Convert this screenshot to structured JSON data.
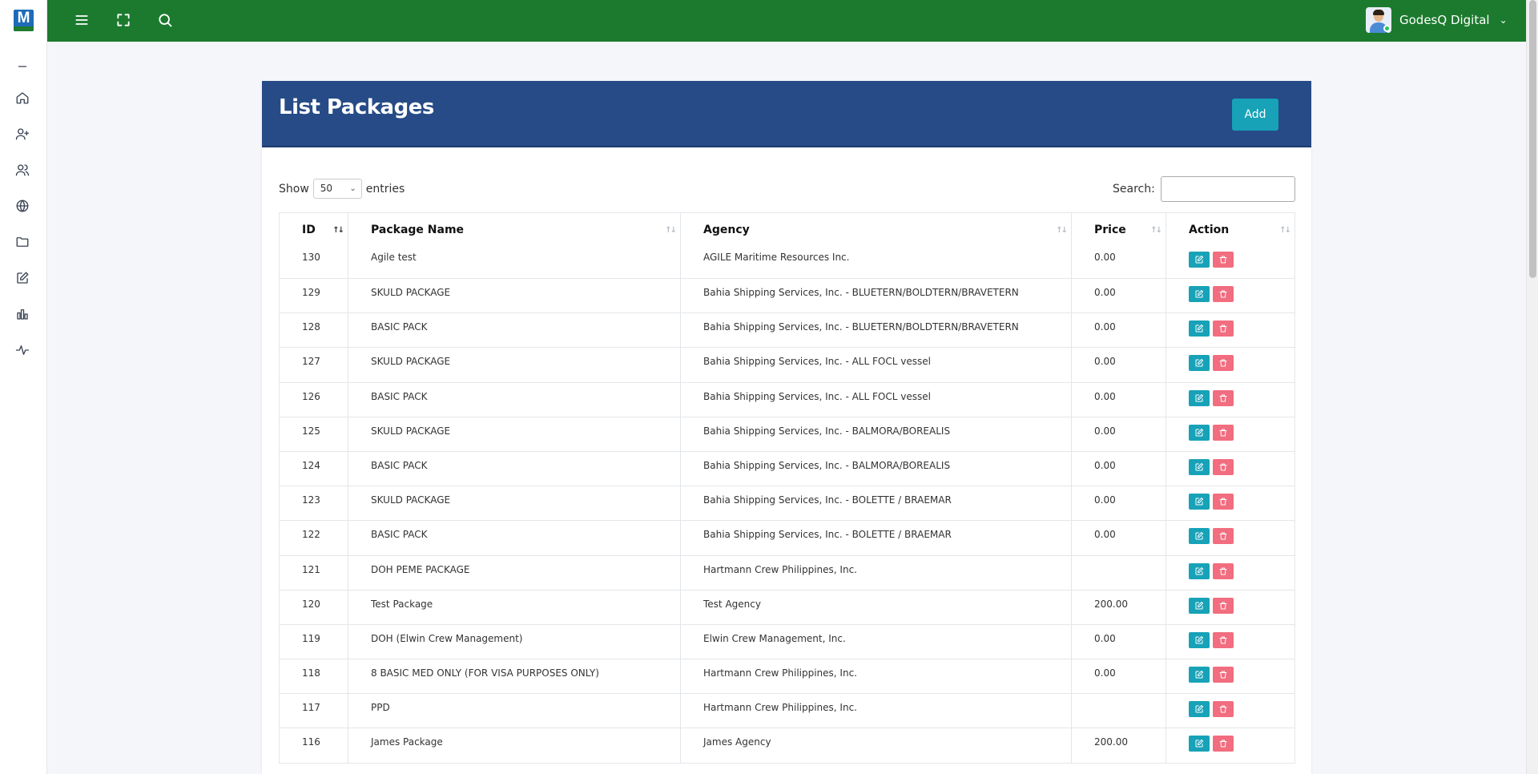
{
  "app": {
    "logo_text": "M",
    "user_name": "GodesQ Digital"
  },
  "sidebar": {
    "items": [
      {
        "name": "collapse",
        "icon": "minus-icon"
      },
      {
        "name": "home",
        "icon": "home-icon"
      },
      {
        "name": "add-user",
        "icon": "user-plus-icon"
      },
      {
        "name": "users",
        "icon": "users-icon"
      },
      {
        "name": "globe",
        "icon": "globe-icon"
      },
      {
        "name": "folder",
        "icon": "folder-icon"
      },
      {
        "name": "edit",
        "icon": "edit-icon"
      },
      {
        "name": "reports",
        "icon": "bar-chart-icon"
      },
      {
        "name": "activity",
        "icon": "activity-icon"
      }
    ]
  },
  "page": {
    "title": "List Packages",
    "add_label": "Add",
    "show_label": "Show",
    "entries_value": "50",
    "entries_label": "entries",
    "search_label": "Search:"
  },
  "table": {
    "headers": [
      "ID",
      "Package Name",
      "Agency",
      "Price",
      "Action"
    ],
    "rows": [
      {
        "id": "130",
        "name": "Agile test",
        "agency": "AGILE Maritime Resources Inc.",
        "price": "0.00"
      },
      {
        "id": "129",
        "name": "SKULD PACKAGE",
        "agency": "Bahia Shipping Services, Inc. - BLUETERN/BOLDTERN/BRAVETERN",
        "price": "0.00"
      },
      {
        "id": "128",
        "name": "BASIC PACK",
        "agency": "Bahia Shipping Services, Inc. - BLUETERN/BOLDTERN/BRAVETERN",
        "price": "0.00"
      },
      {
        "id": "127",
        "name": "SKULD PACKAGE",
        "agency": "Bahia Shipping Services, Inc. - ALL FOCL vessel",
        "price": "0.00"
      },
      {
        "id": "126",
        "name": "BASIC PACK",
        "agency": "Bahia Shipping Services, Inc. - ALL FOCL vessel",
        "price": "0.00"
      },
      {
        "id": "125",
        "name": "SKULD PACKAGE",
        "agency": "Bahia Shipping Services, Inc. - BALMORA/BOREALIS",
        "price": "0.00"
      },
      {
        "id": "124",
        "name": "BASIC PACK",
        "agency": "Bahia Shipping Services, Inc. - BALMORA/BOREALIS",
        "price": "0.00"
      },
      {
        "id": "123",
        "name": "SKULD PACKAGE",
        "agency": "Bahia Shipping Services, Inc. - BOLETTE / BRAEMAR",
        "price": "0.00"
      },
      {
        "id": "122",
        "name": "BASIC PACK",
        "agency": "Bahia Shipping Services, Inc. - BOLETTE / BRAEMAR",
        "price": "0.00"
      },
      {
        "id": "121",
        "name": "DOH PEME PACKAGE",
        "agency": "Hartmann Crew Philippines, Inc.",
        "price": ""
      },
      {
        "id": "120",
        "name": "Test Package",
        "agency": "Test Agency",
        "price": "200.00"
      },
      {
        "id": "119",
        "name": "DOH (Elwin Crew Management)",
        "agency": "Elwin Crew Management, Inc.",
        "price": "0.00"
      },
      {
        "id": "118",
        "name": "8 BASIC MED ONLY (FOR VISA PURPOSES ONLY)",
        "agency": "Hartmann Crew Philippines, Inc.",
        "price": "0.00"
      },
      {
        "id": "117",
        "name": "PPD",
        "agency": "Hartmann Crew Philippines, Inc.",
        "price": ""
      },
      {
        "id": "116",
        "name": "James Package",
        "agency": "James Agency",
        "price": "200.00"
      }
    ]
  },
  "colors": {
    "topbar": "#1b7a2e",
    "card_header": "#264b86",
    "edit_button": "#17a2b8",
    "delete_button": "#f16d7f"
  }
}
